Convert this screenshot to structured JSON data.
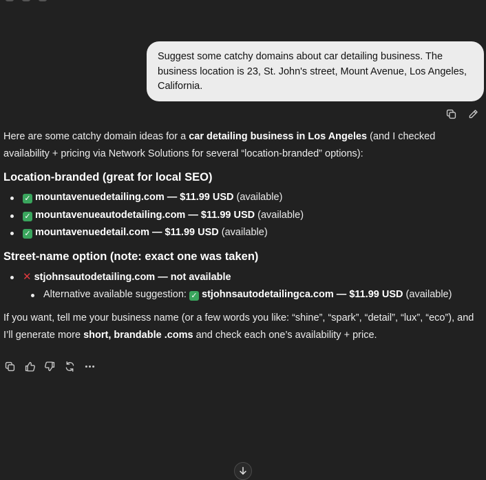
{
  "user_message": "Suggest some catchy domains about car detailing business. The business location is 23, St. John's street, Mount Avenue, Los Angeles, California.",
  "assistant": {
    "intro_pre": "Here are some catchy domain ideas for a ",
    "intro_bold": "car detailing business in Los Angeles",
    "intro_post": " (and I checked availability + pricing via Network Solutions for several “location-branded” options):",
    "section1_heading": "Location-branded (great for local SEO)",
    "section1_items": [
      {
        "domain": "mountavenuedetailing.com",
        "price": "$11.99 USD",
        "status": "(available)"
      },
      {
        "domain": "mountavenueautodetailing.com",
        "price": "$11.99 USD",
        "status": "(available)"
      },
      {
        "domain": "mountavenuedetail.com",
        "price": "$11.99 USD",
        "status": "(available)"
      }
    ],
    "section2_heading": "Street-name option (note: exact one was taken)",
    "taken_domain": "stjohnsautodetailing.com",
    "taken_status": "not available",
    "alt_label": "Alternative available suggestion: ",
    "alt_domain": "stjohnsautodetailingca.com",
    "alt_price": "$11.99 USD",
    "alt_status": "(available)",
    "outro_pre": "If you want, tell me your business name (or a few words you like: “shine”, “spark”, “detail”, “lux”, “eco”), and I’ll generate more ",
    "outro_bold": "short, brandable .coms",
    "outro_post": " and check each one’s availability + price.",
    "dash": " — "
  },
  "icons": {
    "user_actions": [
      "copy-icon",
      "edit-icon"
    ],
    "assistant_actions": [
      "copy-icon",
      "thumbs-up-icon",
      "thumbs-down-icon",
      "regenerate-icon",
      "more-icon"
    ],
    "scroll": "arrow-down-icon"
  }
}
